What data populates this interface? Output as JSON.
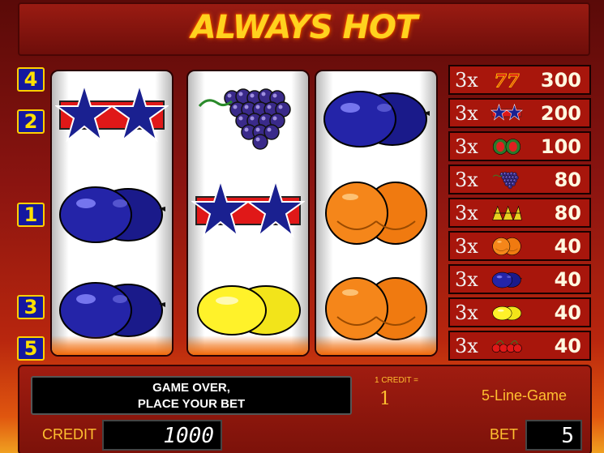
{
  "game": {
    "title": "ALWAYS HOT"
  },
  "line_markers": {
    "top": [
      "4",
      "2"
    ],
    "middle": [
      "1"
    ],
    "bottom": [
      "3",
      "5"
    ]
  },
  "reels": [
    [
      "star",
      "plum",
      "plum"
    ],
    [
      "grapes",
      "star",
      "lemon"
    ],
    [
      "plum",
      "orange",
      "orange"
    ]
  ],
  "paytable": [
    {
      "mult": "3x",
      "symbol": "seven",
      "value": "300"
    },
    {
      "mult": "3x",
      "symbol": "star",
      "value": "200"
    },
    {
      "mult": "3x",
      "symbol": "melon",
      "value": "100"
    },
    {
      "mult": "3x",
      "symbol": "grapes",
      "value": "80"
    },
    {
      "mult": "3x",
      "symbol": "bell",
      "value": "80"
    },
    {
      "mult": "3x",
      "symbol": "orange",
      "value": "40"
    },
    {
      "mult": "3x",
      "symbol": "plum",
      "value": "40"
    },
    {
      "mult": "3x",
      "symbol": "lemon",
      "value": "40"
    },
    {
      "mult": "3x",
      "symbol": "cherry",
      "value": "40"
    }
  ],
  "message": {
    "line1": "GAME OVER,",
    "line2": "PLACE YOUR BET"
  },
  "credit_rate": {
    "label": "1 CREDIT =",
    "value": "1"
  },
  "game_mode": "5-Line-Game",
  "credit": {
    "label": "CREDIT",
    "value": "1000"
  },
  "bet": {
    "label": "BET",
    "value": "5"
  },
  "colors": {
    "gold": "#ffc030",
    "reel_white": "#ffffff",
    "panel_red": "#a01c10",
    "marker_blue": "#1418a0"
  }
}
